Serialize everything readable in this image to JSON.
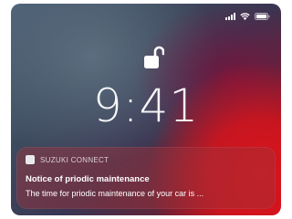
{
  "status_bar": {
    "signal": "signal-icon",
    "wifi": "wifi-icon",
    "battery": "battery-icon"
  },
  "lock_screen": {
    "lock_icon": "unlocked-padlock-icon",
    "time": "9:41"
  },
  "notification": {
    "app_icon": "app-icon",
    "app_name": "SUZUKI CONNECT",
    "title": "Notice of priodic maintenance",
    "body": "The time for priodic maintenance of your car is ..."
  },
  "colors": {
    "wallpaper_blue": "#4d6176",
    "wallpaper_red": "#d8141c",
    "text": "#ffffff"
  }
}
